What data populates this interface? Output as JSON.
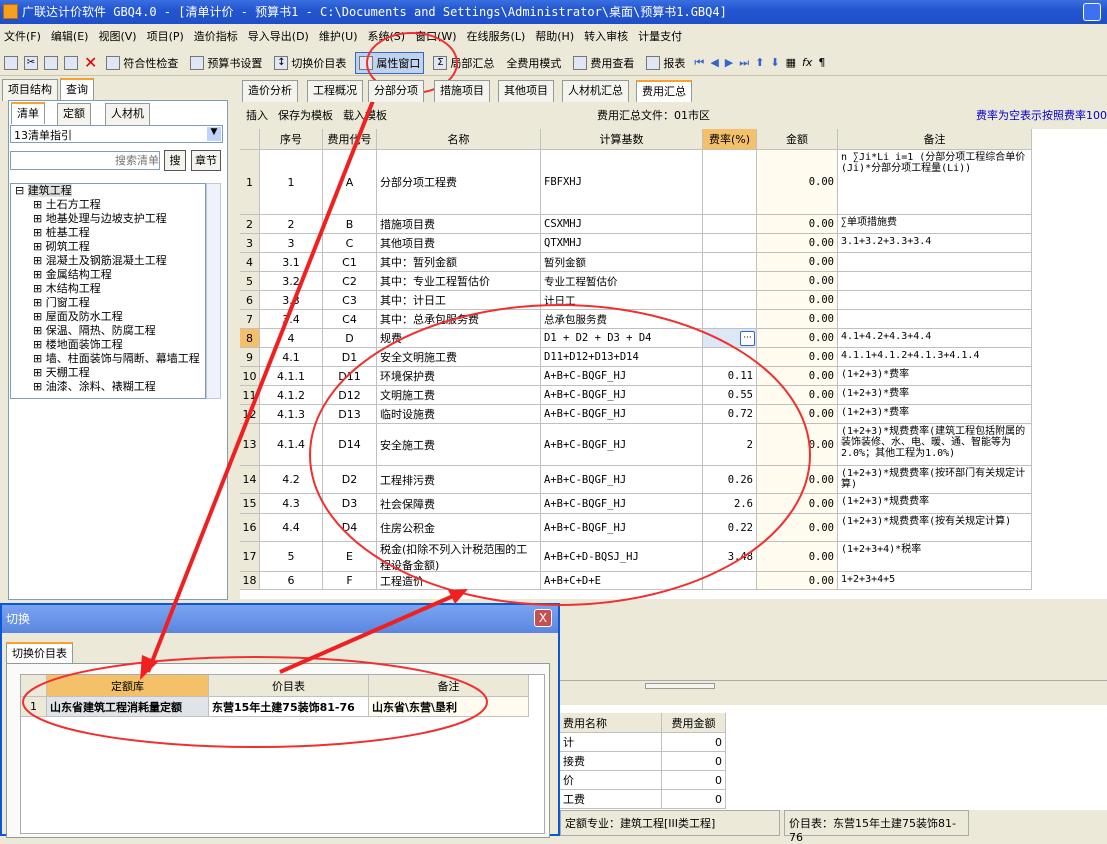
{
  "window": {
    "title": "广联达计价软件 GBQ4.0 - [清单计价 - 预算书1 - C:\\Documents and Settings\\Administrator\\桌面\\预算书1.GBQ4]"
  },
  "menu": [
    "文件(F)",
    "编辑(E)",
    "视图(V)",
    "项目(P)",
    "造价指标",
    "导入导出(D)",
    "维护(U)",
    "系统(S)",
    "窗口(W)",
    "在线服务(L)",
    "帮助(H)",
    "转入审核",
    "计量支付"
  ],
  "toolbar": [
    "符合性检查",
    "预算书设置",
    "切换价目表",
    "属性窗口",
    "局部汇总",
    "全费用模式",
    "费用查看",
    "报表"
  ],
  "left": {
    "tabs": [
      "项目结构",
      "查询"
    ],
    "subtabs": [
      "清单",
      "定额",
      "人材机"
    ],
    "select": "13清单指引",
    "search_placeholder": "搜索清单",
    "search_btn": "搜",
    "chapter_btn": "章节",
    "tree_root": "建筑工程",
    "tree": [
      "土石方工程",
      "地基处理与边坡支护工程",
      "桩基工程",
      "砌筑工程",
      "混凝土及钢筋混凝土工程",
      "金属结构工程",
      "木结构工程",
      "门窗工程",
      "屋面及防水工程",
      "保温、隔热、防腐工程",
      "楼地面装饰工程",
      "墙、柱面装饰与隔断、幕墙工程",
      "天棚工程",
      "油漆、涂料、裱糊工程"
    ]
  },
  "main": {
    "tabs": [
      "造价分析",
      "工程概况",
      "分部分项",
      "措施项目",
      "其他项目",
      "人材机汇总",
      "费用汇总"
    ],
    "subtoolbar": [
      "插入",
      "保存为模板",
      "载入模板"
    ],
    "summary_file": "费用汇总文件：01市区",
    "hint": "费率为空表示按照费率100",
    "columns": [
      "序号",
      "费用代号",
      "名称",
      "计算基数",
      "费率(%)",
      "金额",
      "备注"
    ],
    "rows": [
      [
        "1",
        "1",
        "A",
        "分部分项工程费",
        "FBFXHJ",
        "",
        "0.00",
        "n ∑Ji*Li i=1 (分部分项工程综合单价 (Ji)*分部分项工程量(Li))"
      ],
      [
        "2",
        "2",
        "B",
        "措施项目费",
        "CSXMHJ",
        "",
        "0.00",
        "∑单项措施费"
      ],
      [
        "3",
        "3",
        "C",
        "其他项目费",
        "QTXMHJ",
        "",
        "0.00",
        "3.1+3.2+3.3+3.4"
      ],
      [
        "4",
        "3.1",
        "C1",
        "其中：暂列金额",
        "暂列金额",
        "",
        "0.00",
        ""
      ],
      [
        "5",
        "3.2",
        "C2",
        "其中：专业工程暂估价",
        "专业工程暂估价",
        "",
        "0.00",
        ""
      ],
      [
        "6",
        "3.3",
        "C3",
        "其中：计日工",
        "计日工",
        "",
        "0.00",
        ""
      ],
      [
        "7",
        "3.4",
        "C4",
        "其中：总承包服务费",
        "总承包服务费",
        "",
        "0.00",
        ""
      ],
      [
        "8",
        "4",
        "D",
        "规费",
        "D1 + D2 + D3 + D4",
        "",
        "0.00",
        "4.1+4.2+4.3+4.4"
      ],
      [
        "9",
        "4.1",
        "D1",
        "安全文明施工费",
        "D11+D12+D13+D14",
        "",
        "0.00",
        "4.1.1+4.1.2+4.1.3+4.1.4"
      ],
      [
        "10",
        "4.1.1",
        "D11",
        "环境保护费",
        "A+B+C-BQGF_HJ",
        "0.11",
        "0.00",
        "(1+2+3)*费率"
      ],
      [
        "11",
        "4.1.2",
        "D12",
        "文明施工费",
        "A+B+C-BQGF_HJ",
        "0.55",
        "0.00",
        "(1+2+3)*费率"
      ],
      [
        "12",
        "4.1.3",
        "D13",
        "临时设施费",
        "A+B+C-BQGF_HJ",
        "0.72",
        "0.00",
        "(1+2+3)*费率"
      ],
      [
        "13",
        "4.1.4",
        "D14",
        "安全施工费",
        "A+B+C-BQGF_HJ",
        "2",
        "0.00",
        "(1+2+3)*规费费率(建筑工程包括附属的装饰装修、水、电、暖、通、智能等为2.0%；其他工程为1.0%)"
      ],
      [
        "14",
        "4.2",
        "D2",
        "工程排污费",
        "A+B+C-BQGF_HJ",
        "0.26",
        "0.00",
        "(1+2+3)*规费费率(按环部门有关规定计算)"
      ],
      [
        "15",
        "4.3",
        "D3",
        "社会保障费",
        "A+B+C-BQGF_HJ",
        "2.6",
        "0.00",
        "(1+2+3)*规费费率"
      ],
      [
        "16",
        "4.4",
        "D4",
        "住房公积金",
        "A+B+C-BQGF_HJ",
        "0.22",
        "0.00",
        "(1+2+3)*规费费率(按有关规定计算)"
      ],
      [
        "17",
        "5",
        "E",
        "税金(扣除不列入计税范围的工程设备金额)",
        "A+B+C+D-BQSJ_HJ",
        "3.48",
        "0.00",
        "(1+2+3+4)*税率"
      ],
      [
        "18",
        "6",
        "F",
        "工程造价",
        "A+B+C+D+E",
        "",
        "0.00",
        "1+2+3+4+5"
      ]
    ]
  },
  "bottom": {
    "columns": [
      "费用名称",
      "费用金额"
    ],
    "rows": [
      [
        "计",
        "0"
      ],
      [
        "接费",
        "0"
      ],
      [
        "价",
        "0"
      ],
      [
        "工费",
        "0"
      ]
    ]
  },
  "status": {
    "quota": "定额专业：建筑工程[III类工程]",
    "price": "价目表：东营15年土建75装饰81-76"
  },
  "dialog": {
    "title": "切换",
    "close": "X",
    "tab": "切换价目表",
    "columns": [
      "定额库",
      "价目表",
      "备注"
    ],
    "rows": [
      [
        "1",
        "山东省建筑工程消耗量定额",
        "东营15年土建75装饰81-76",
        "山东省\\东营\\垦利"
      ]
    ]
  }
}
